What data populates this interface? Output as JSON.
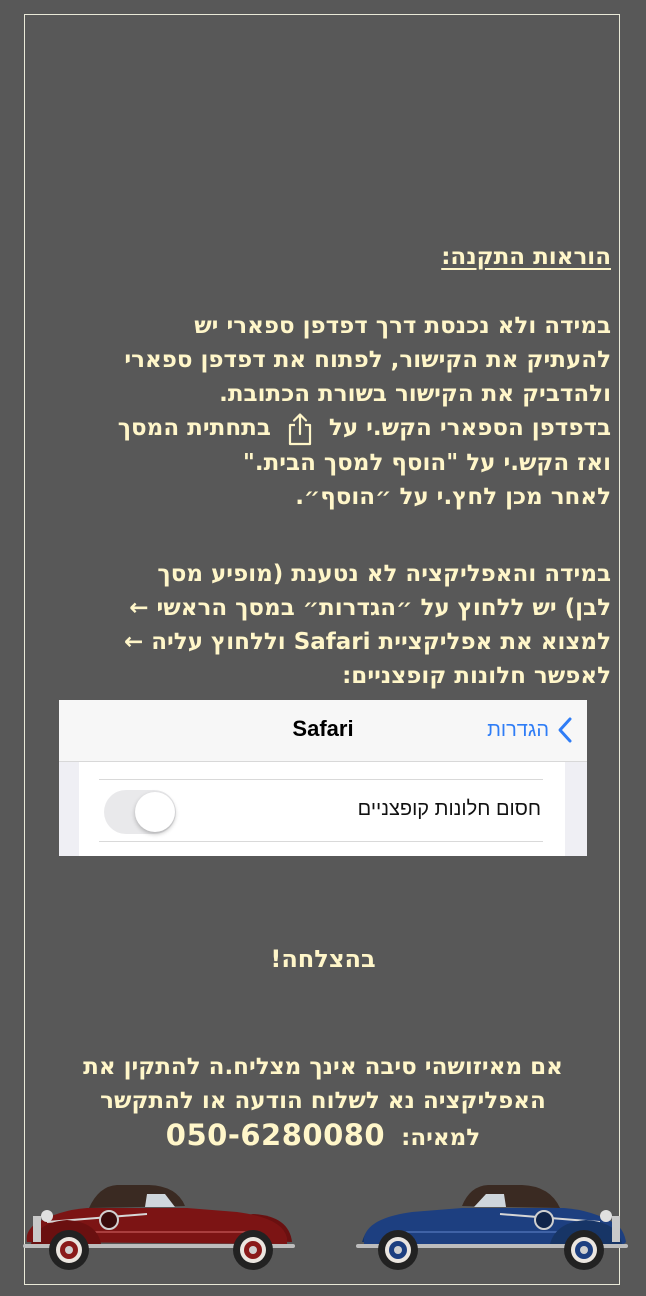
{
  "instructions": {
    "title": "הוראות התקנה:",
    "para1_lines": [
      "במידה ולא נכנסת דרך דפדפן ספארי יש",
      "להעתיק את הקישור, לפתוח את דפדפן ספארי",
      "ולהדביק את הקישור בשורת הכתובת."
    ],
    "line4_before": "בדפדפן הספארי הקש.י על",
    "line4_after": "בתחתית המסך",
    "line5": "ואז הקש.י על \"הוסף למסך הבית.\"",
    "line6": "לאחר מכן לחץ.י על ״הוסף״.",
    "para2_line1": "במידה והאפליקציה לא נטענת (מופיע מסך",
    "para2_line2": "לבן) יש ללחוץ על ״הגדרות״ במסך הראשי ←",
    "para2_line3_a": "למצוא את אפליקציית",
    "para2_line3_app": "Safari",
    "para2_line3_b": "וללחוץ עליה ←",
    "para2_line4": "לאפשר חלונות קופצניים:"
  },
  "settings_screenshot": {
    "nav_title": "Safari",
    "back_label": "הגדרות",
    "row_label": "חסום חלונות קופצניים",
    "toggle_on": false
  },
  "success_text": "בהצלחה!",
  "contact": {
    "line1": "אם מאיזושהי סיבה אינך מצליח.ה להתקין את",
    "line2": "האפליקציה נא לשלוח הודעה או להתקשר",
    "line3_label": "למאיה:",
    "phone": "050-6280080"
  },
  "colors": {
    "background": "#585858",
    "text": "#fff6c9",
    "ios_blue": "#2f7df6",
    "car_left": "#7c1414",
    "car_right": "#1d3f80"
  },
  "icons": [
    "share-icon",
    "chevron-left-icon",
    "vintage-car-icon"
  ]
}
